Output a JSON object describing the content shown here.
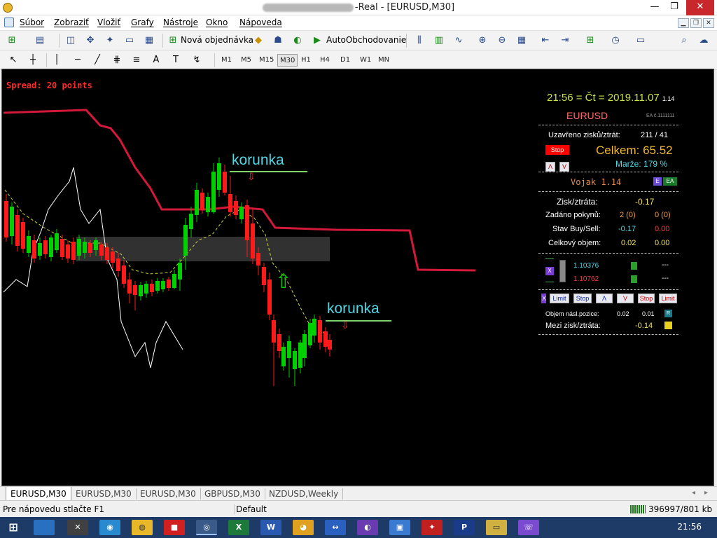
{
  "window": {
    "title_suffix": "-Real - [EURUSD,M30]",
    "minimize": "—",
    "restore": "❐",
    "close": "✕"
  },
  "menu": {
    "items": [
      "Súbor",
      "Zobraziť",
      "Vložiť",
      "Grafy",
      "Nástroje",
      "Okno",
      "Nápoveda"
    ]
  },
  "toolbar": {
    "new_order": "Nová objednávka",
    "autotrading": "AutoObchodovanie",
    "timeframes": [
      "M1",
      "M5",
      "M15",
      "M30",
      "H1",
      "H4",
      "D1",
      "W1",
      "MN"
    ],
    "active_timeframe": "M30"
  },
  "chart": {
    "spread": "Spread: 20 points",
    "annotation_1": "korunka",
    "annotation_2": "korunka",
    "colors": {
      "bull": "#00d000",
      "bear": "#ff1a1a",
      "line": "#d3193a"
    }
  },
  "panel": {
    "datetime": "21:56 = Čt = 2019.11.07",
    "version_small": "1.14",
    "symbol": "EURUSD",
    "ea_tag": "EA č.1111111",
    "closed_label": "Uzavřeno zisků/ztrát:",
    "closed_value": "211 / 41",
    "stop_btn": "Stop",
    "total_label": "Celkem: 65.52",
    "btn_up": "Λ",
    "btn_down": "V",
    "margin_label": "Marže:",
    "margin_value": "179 %",
    "name": "Vojak 1.14",
    "tag_e": "E",
    "tag_ea": "EA",
    "pl_label": "Zisk/ztráta:",
    "pl_value": "-0.17",
    "orders_label": "Zadáno pokynů:",
    "orders_buy": "2 (0)",
    "orders_sell": "0 (0)",
    "state_label": "Stav Buy/Sell:",
    "state_buy": "-0.17",
    "state_sell": "0.00",
    "volume_label": "Celkový objem:",
    "volume_buy": "0.02",
    "volume_sell": "0.00",
    "x_btn": "X",
    "price_buy": "1.10376",
    "price_sell": "1.10762",
    "dash_1": "---",
    "dash_2": "---",
    "limit_1": "Limit",
    "stop_2": "Stop",
    "lambda": "Λ",
    "vee": "V",
    "stop_3": "Stop",
    "limit_4": "Limit",
    "next_vol_label": "Objem násl.pozice:",
    "next_vol_1": "0.02",
    "next_vol_2": "0.01",
    "r_btn": "R",
    "between_label": "Mezi zisk/ztráta:",
    "between_value": "-0.14"
  },
  "tabs": {
    "items": [
      "EURUSD,M30",
      "EURUSD,M30",
      "EURUSD,M30",
      "GBPUSD,M30",
      "NZDUSD,Weekly"
    ]
  },
  "status": {
    "help": "Pre nápovedu stlačte F1",
    "profile": "Default",
    "traffic": "396997/801 kb"
  },
  "taskbar": {
    "time": "21:56"
  }
}
